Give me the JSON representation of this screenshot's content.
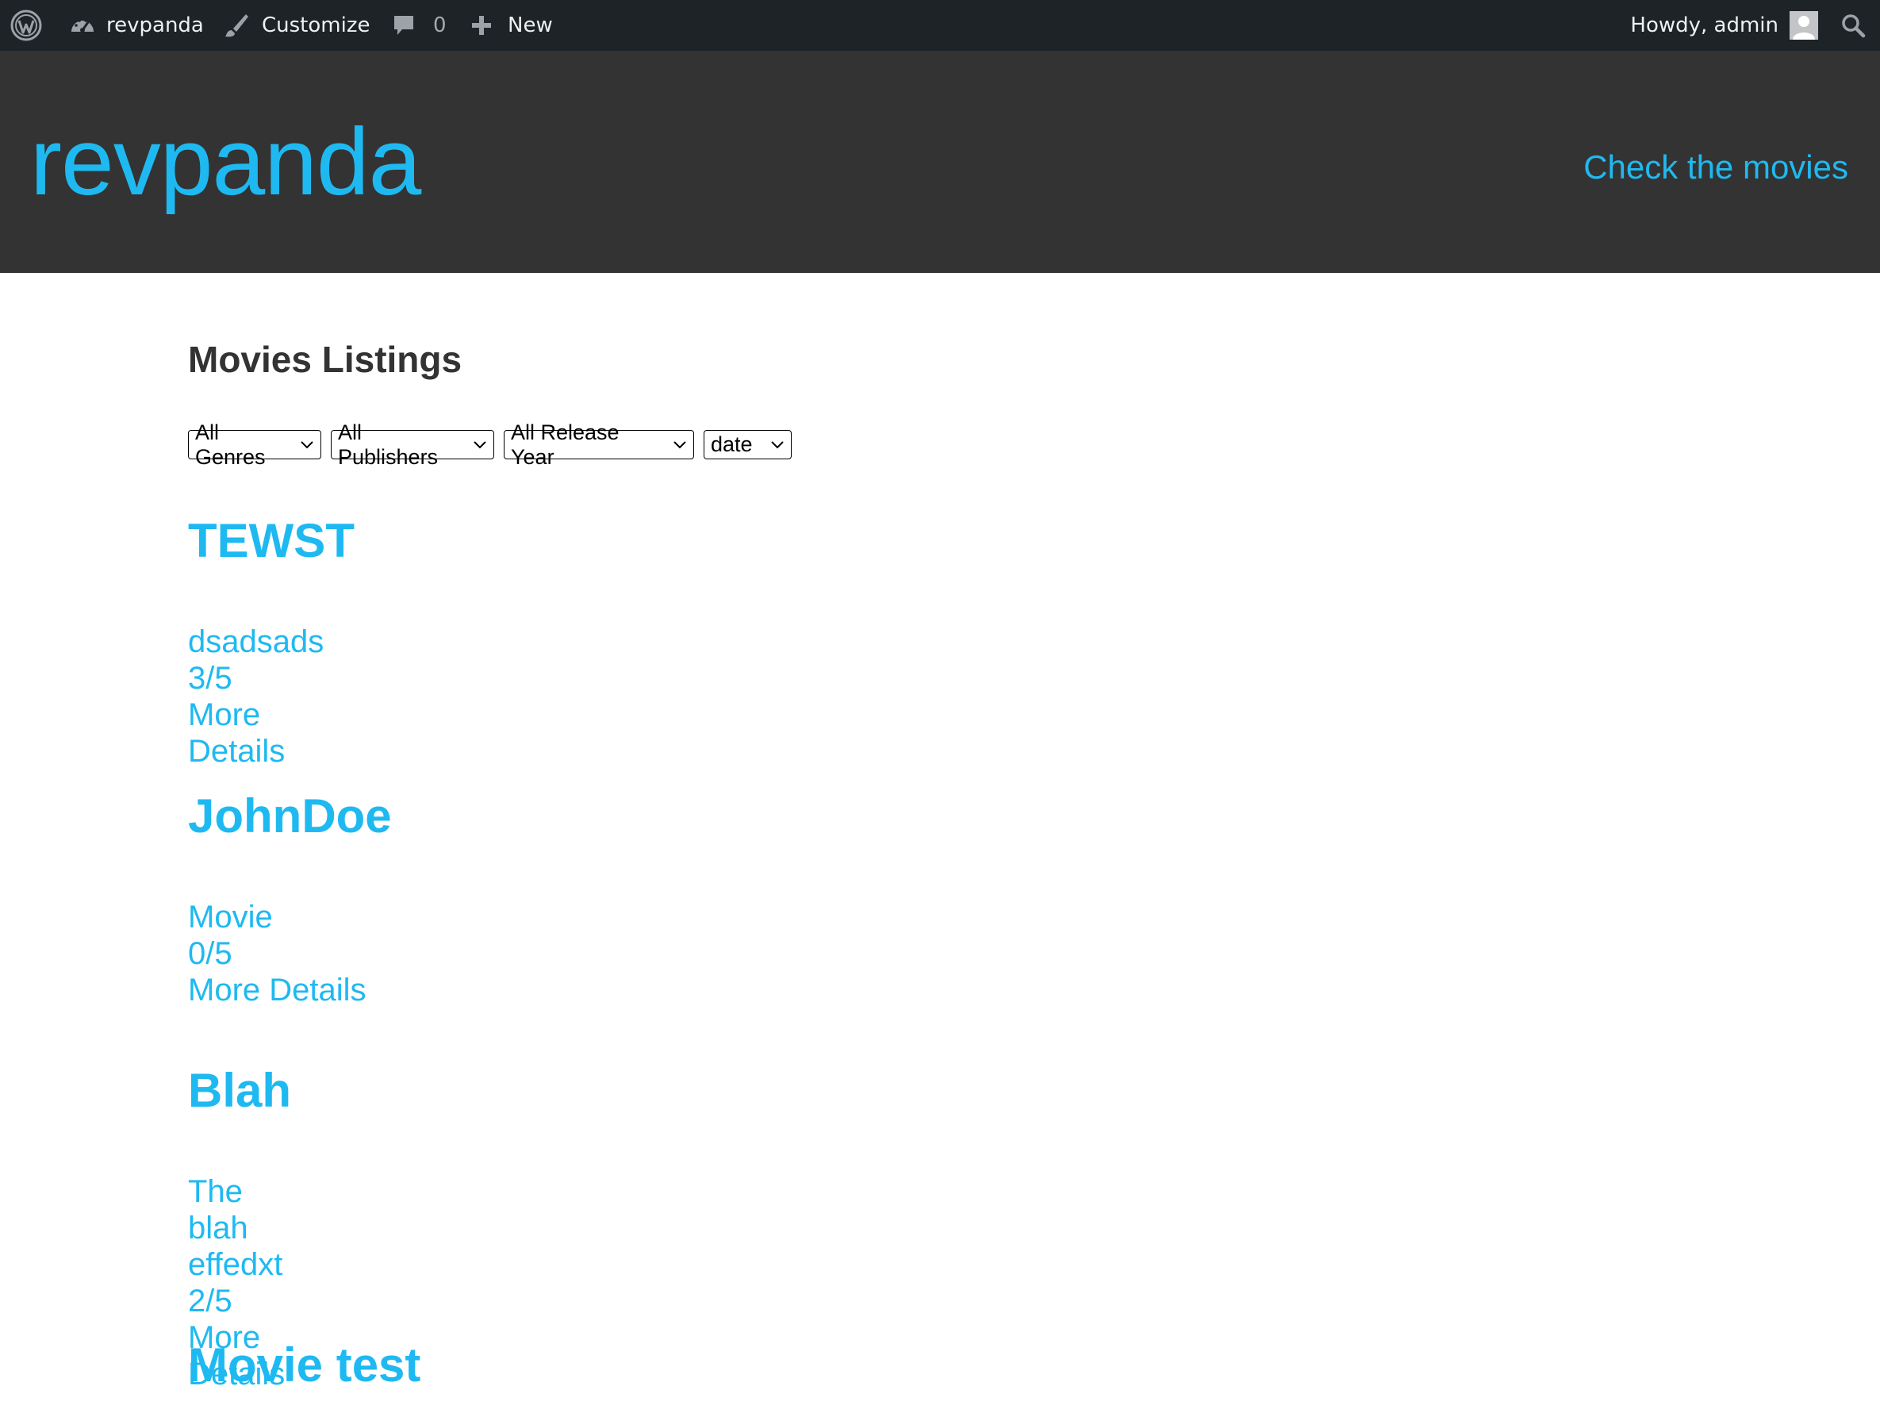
{
  "adminbar": {
    "site_name": "revpanda",
    "customize_label": "Customize",
    "comments_count": "0",
    "new_label": "New",
    "howdy_label": "Howdy, admin"
  },
  "header": {
    "site_title": "revpanda",
    "nav_link": "Check the movies"
  },
  "main": {
    "heading": "Movies Listings",
    "filters": {
      "genres": "All Genres",
      "publishers": "All Publishers",
      "release_year": "All Release Year",
      "sort": "date"
    },
    "movies": [
      {
        "title": "TEWST",
        "description": "dsadsads",
        "rating": "3/5",
        "link": "More Details"
      },
      {
        "title": "JohnDoe",
        "description": "Movie",
        "rating": "0/5",
        "link": "More Details"
      },
      {
        "title": "Blah",
        "description": "The blah effedxt",
        "rating": "2/5",
        "link": "More Details"
      },
      {
        "title": "Movie test"
      }
    ]
  },
  "colors": {
    "accent": "#1fb9f1",
    "header_bg": "#333333",
    "adminbar_bg": "#1d2327"
  }
}
